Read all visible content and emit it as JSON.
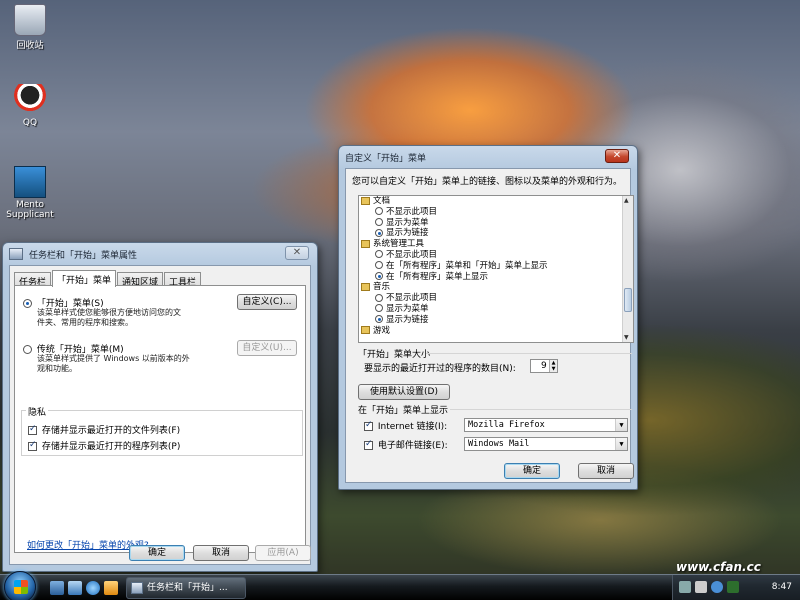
{
  "desktop": {
    "icons": [
      {
        "label": "回收站"
      },
      {
        "label": "QQ"
      },
      {
        "label": "Mento Supplicant"
      }
    ]
  },
  "taskbar_props": {
    "title": "任务栏和「开始」菜单属性",
    "tabs": [
      "任务栏",
      "「开始」菜单",
      "通知区域",
      "工具栏"
    ],
    "start_menu_option": {
      "label": "「开始」菜单(S)",
      "desc_line1": "该菜单样式使您能够很方便地访问您的文",
      "desc_line2": "件夹、常用的程序和搜索。",
      "selected": true,
      "customize_button": "自定义(C)..."
    },
    "classic_option": {
      "label": "传统「开始」菜单(M)",
      "desc_line1": "该菜单样式提供了 Windows 以前版本的外",
      "desc_line2": "观和功能。",
      "selected": false,
      "customize_button": "自定义(U)..."
    },
    "privacy": {
      "legend": "隐私",
      "checkboxes": [
        {
          "label": "存储并显示最近打开的文件列表(F)",
          "checked": true
        },
        {
          "label": "存储并显示最近打开的程序列表(P)",
          "checked": true
        }
      ]
    },
    "help_link": "如何更改「开始」菜单的外观?",
    "buttons": {
      "ok": "确定",
      "cancel": "取消",
      "apply": "应用(A)"
    }
  },
  "customize": {
    "title": "自定义「开始」菜单",
    "intro": "您可以自定义「开始」菜单上的链接、图标以及菜单的外观和行为。",
    "tree": [
      {
        "kind": "cat",
        "label": "文档"
      },
      {
        "kind": "opt",
        "label": "不显示此项目",
        "selected": false
      },
      {
        "kind": "opt",
        "label": "显示为菜单",
        "selected": false
      },
      {
        "kind": "opt",
        "label": "显示为链接",
        "selected": true
      },
      {
        "kind": "cat",
        "label": "系统管理工具"
      },
      {
        "kind": "opt",
        "label": "不显示此项目",
        "selected": false
      },
      {
        "kind": "opt",
        "label": "在「所有程序」菜单和「开始」菜单上显示",
        "selected": false
      },
      {
        "kind": "opt",
        "label": "在「所有程序」菜单上显示",
        "selected": true
      },
      {
        "kind": "cat",
        "label": "音乐"
      },
      {
        "kind": "opt",
        "label": "不显示此项目",
        "selected": false
      },
      {
        "kind": "opt",
        "label": "显示为菜单",
        "selected": false
      },
      {
        "kind": "opt",
        "label": "显示为链接",
        "selected": true
      },
      {
        "kind": "cat",
        "label": "游戏"
      }
    ],
    "menu_size": {
      "legend": "「开始」菜单大小",
      "label": "要显示的最近打开过的程序的数目(N):",
      "value": "9"
    },
    "default_button": "使用默认设置(D)",
    "show_on_menu": {
      "legend": "在「开始」菜单上显示",
      "internet_label": "Internet 链接(I):",
      "internet_checked": true,
      "internet_value": "Mozilla Firefox",
      "email_label": "电子邮件链接(E):",
      "email_checked": true,
      "email_value": "Windows Mail"
    },
    "buttons": {
      "ok": "确定",
      "cancel": "取消"
    }
  },
  "taskbar": {
    "active_task": "任务栏和「开始」...",
    "clock": "8:47"
  },
  "watermark": "www.cfan.cc"
}
